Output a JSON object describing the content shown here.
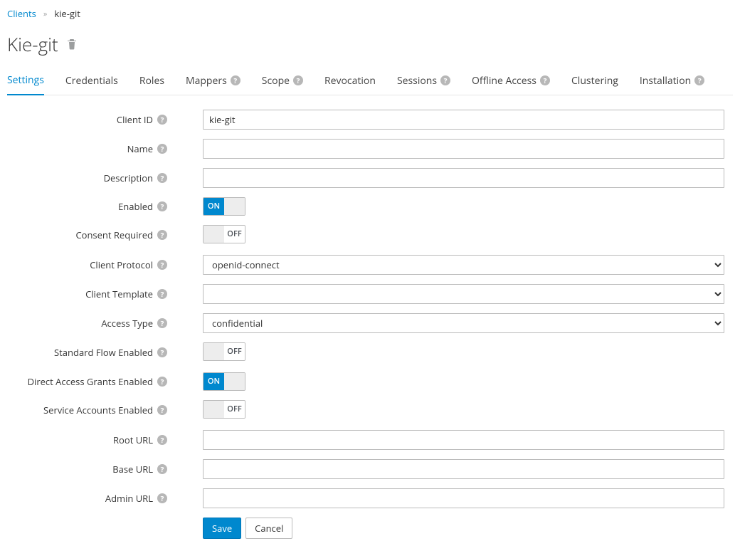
{
  "breadcrumb": {
    "parent": "Clients",
    "current": "kie-git"
  },
  "page_title": "Kie-git",
  "tabs": [
    {
      "label": "Settings",
      "help": false,
      "active": true
    },
    {
      "label": "Credentials",
      "help": false,
      "active": false
    },
    {
      "label": "Roles",
      "help": false,
      "active": false
    },
    {
      "label": "Mappers",
      "help": true,
      "active": false
    },
    {
      "label": "Scope",
      "help": true,
      "active": false
    },
    {
      "label": "Revocation",
      "help": false,
      "active": false
    },
    {
      "label": "Sessions",
      "help": true,
      "active": false
    },
    {
      "label": "Offline Access",
      "help": true,
      "active": false
    },
    {
      "label": "Clustering",
      "help": false,
      "active": false
    },
    {
      "label": "Installation",
      "help": true,
      "active": false
    }
  ],
  "form": {
    "client_id": {
      "label": "Client ID",
      "value": "kie-git"
    },
    "name": {
      "label": "Name",
      "value": ""
    },
    "description": {
      "label": "Description",
      "value": ""
    },
    "enabled": {
      "label": "Enabled",
      "on": true,
      "on_text": "ON",
      "off_text": "OFF"
    },
    "consent_required": {
      "label": "Consent Required",
      "on": false,
      "on_text": "ON",
      "off_text": "OFF"
    },
    "client_protocol": {
      "label": "Client Protocol",
      "value": "openid-connect",
      "options": [
        "openid-connect"
      ]
    },
    "client_template": {
      "label": "Client Template",
      "value": "",
      "options": [
        ""
      ]
    },
    "access_type": {
      "label": "Access Type",
      "value": "confidential",
      "options": [
        "confidential"
      ]
    },
    "standard_flow_enabled": {
      "label": "Standard Flow Enabled",
      "on": false,
      "on_text": "ON",
      "off_text": "OFF"
    },
    "direct_access_grants_enabled": {
      "label": "Direct Access Grants Enabled",
      "on": true,
      "on_text": "ON",
      "off_text": "OFF"
    },
    "service_accounts_enabled": {
      "label": "Service Accounts Enabled",
      "on": false,
      "on_text": "ON",
      "off_text": "OFF"
    },
    "root_url": {
      "label": "Root URL",
      "value": ""
    },
    "base_url": {
      "label": "Base URL",
      "value": ""
    },
    "admin_url": {
      "label": "Admin URL",
      "value": ""
    }
  },
  "actions": {
    "save": "Save",
    "cancel": "Cancel"
  }
}
